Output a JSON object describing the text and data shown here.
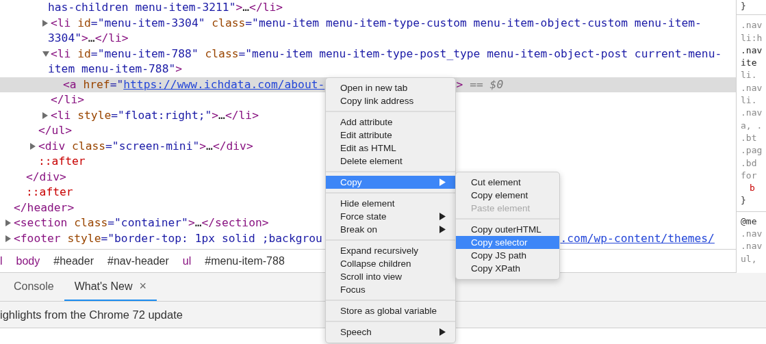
{
  "dom_tree": [
    {
      "selected": false,
      "children": [
        {
          "selected": false,
          "children": [
            {
              "selected": false,
              "children": [
                {
                  "selected": false,
                  "wrapped": [
                    [
                      {
                        "kind": "val",
                        "text": "has-children menu-item-3211\""
                      },
                      {
                        "kind": "tag",
                        "text": ">"
                      },
                      {
                        "kind": "text",
                        "text": "…"
                      },
                      {
                        "kind": "tag",
                        "text": "</li>"
                      }
                    ]
                  ]
                },
                {
                  "selected": false,
                  "expanded": false,
                  "open": [
                    {
                      "kind": "tag",
                      "text": "<li"
                    },
                    {
                      "kind": "attr",
                      "text": " id"
                    },
                    {
                      "kind": "val",
                      "text": "=\"menu-item-3304\""
                    },
                    {
                      "kind": "attr",
                      "text": " class"
                    },
                    {
                      "kind": "val",
                      "text": "=\"menu-item menu-item-type-custom menu-item-object-custom menu-item-"
                    }
                  ],
                  "wrapped": [
                    [
                      {
                        "kind": "val",
                        "text": "3304\""
                      },
                      {
                        "kind": "tag",
                        "text": ">"
                      },
                      {
                        "kind": "text",
                        "text": "…"
                      },
                      {
                        "kind": "tag",
                        "text": "</li>"
                      }
                    ]
                  ]
                },
                {
                  "selected": false,
                  "expanded": true,
                  "open": [
                    {
                      "kind": "tag",
                      "text": "<li"
                    },
                    {
                      "kind": "attr",
                      "text": " id"
                    },
                    {
                      "kind": "val",
                      "text": "=\"menu-item-788\""
                    },
                    {
                      "kind": "attr",
                      "text": " class"
                    },
                    {
                      "kind": "val",
                      "text": "=\"menu-item menu-item-type-post_type menu-item-object-post current-menu-"
                    }
                  ],
                  "wrapped": [
                    [
                      {
                        "kind": "val",
                        "text": "item menu-item-788\""
                      },
                      {
                        "kind": "tag",
                        "text": ">"
                      }
                    ]
                  ],
                  "children": [
                    {
                      "selected": true,
                      "open": [
                        {
                          "kind": "tag",
                          "text": "<a"
                        },
                        {
                          "kind": "attr",
                          "text": " href"
                        },
                        {
                          "kind": "val",
                          "text": "=\""
                        },
                        {
                          "kind": "link",
                          "text": "https://www.ichdata.com/about-"
                        },
                        {
                          "kind": "tag",
                          "text": ">",
                          "covered_before": true
                        },
                        {
                          "kind": "eq",
                          "text": " == "
                        },
                        {
                          "kind": "eqi",
                          "text": "$0"
                        }
                      ]
                    }
                  ],
                  "close": [
                    {
                      "kind": "tag",
                      "text": "</li>"
                    }
                  ]
                },
                {
                  "selected": false,
                  "expanded": false,
                  "open": [
                    {
                      "kind": "tag",
                      "text": "<li"
                    },
                    {
                      "kind": "attr",
                      "text": " style"
                    },
                    {
                      "kind": "val",
                      "text": "=\"float:right;\""
                    },
                    {
                      "kind": "tag",
                      "text": ">"
                    },
                    {
                      "kind": "text",
                      "text": "…"
                    },
                    {
                      "kind": "tag",
                      "text": "</li>"
                    }
                  ]
                }
              ],
              "close": [
                {
                  "kind": "tag",
                  "text": "</ul>"
                }
              ]
            },
            {
              "selected": false,
              "expanded": false,
              "open": [
                {
                  "kind": "tag",
                  "text": "<div"
                },
                {
                  "kind": "attr",
                  "text": " class"
                },
                {
                  "kind": "val",
                  "text": "=\"screen-mini\""
                },
                {
                  "kind": "tag",
                  "text": ">"
                },
                {
                  "kind": "text",
                  "text": "…"
                },
                {
                  "kind": "tag",
                  "text": "</div>"
                }
              ]
            },
            {
              "selected": false,
              "open": [
                {
                  "kind": "pseudo",
                  "text": "::after"
                }
              ]
            }
          ],
          "close": [
            {
              "kind": "tag",
              "text": "</div>"
            }
          ]
        },
        {
          "selected": false,
          "open": [
            {
              "kind": "pseudo",
              "text": "::after"
            }
          ]
        }
      ],
      "close": [
        {
          "kind": "tag",
          "text": "</header>"
        }
      ]
    },
    {
      "selected": false,
      "expanded": false,
      "open": [
        {
          "kind": "tag",
          "text": "<section"
        },
        {
          "kind": "attr",
          "text": " class"
        },
        {
          "kind": "val",
          "text": "=\"container\""
        },
        {
          "kind": "tag",
          "text": ">"
        },
        {
          "kind": "text",
          "text": "…"
        },
        {
          "kind": "tag",
          "text": "</section>"
        }
      ]
    },
    {
      "selected": false,
      "expanded": false,
      "open": [
        {
          "kind": "tag",
          "text": "<footer"
        },
        {
          "kind": "attr",
          "text": " style"
        },
        {
          "kind": "val",
          "text": "=\"border-top: 1px solid ;backgrou"
        },
        {
          "kind": "link",
          "text": ".com/wp-content/themes/",
          "covered_before": true
        }
      ]
    }
  ],
  "breadcrumbs": [
    {
      "text": "l",
      "kind": "tag"
    },
    {
      "text": "body",
      "kind": "tag"
    },
    {
      "text": "#header",
      "kind": "id"
    },
    {
      "text": "#nav-header",
      "kind": "id"
    },
    {
      "text": "ul",
      "kind": "tag"
    },
    {
      "text": "#menu-item-788",
      "kind": "id"
    }
  ],
  "styles_pane": [
    [
      {
        "text": "}",
        "kind": "brace"
      }
    ],
    [
      {
        "text": ".nav",
        "kind": "dim"
      },
      {
        "text": "li:h",
        "kind": "dim"
      },
      {
        "text": ".nav",
        "kind": "match"
      },
      {
        "text": "ite",
        "kind": "match"
      },
      {
        "text": "li.",
        "kind": "dim"
      },
      {
        "text": ".nav",
        "kind": "dim"
      },
      {
        "text": "li.",
        "kind": "dim"
      },
      {
        "text": ".nav",
        "kind": "dim"
      },
      {
        "text": "a, .",
        "kind": "dim"
      },
      {
        "text": ".bt",
        "kind": "dim"
      },
      {
        "text": ".pag",
        "kind": "dim"
      },
      {
        "text": ".bd",
        "kind": "dim"
      },
      {
        "text": "for",
        "kind": "dim"
      },
      {
        "text": "b",
        "kind": "prop"
      },
      {
        "text": "}",
        "kind": "brace"
      }
    ],
    [
      {
        "text": "@me",
        "kind": "brace"
      },
      {
        "text": ".nav",
        "kind": "dim"
      },
      {
        "text": ".nav",
        "kind": "dim"
      },
      {
        "text": "ul,",
        "kind": "dim"
      }
    ]
  ],
  "drawer_tabs": [
    {
      "label": "Console",
      "selected": false,
      "closable": false
    },
    {
      "label": "What's New",
      "selected": true,
      "closable": true
    }
  ],
  "drawer_close_icon": "×",
  "drawer_content": "ighlights from the Chrome 72 update",
  "context_menu": {
    "groups": [
      [
        {
          "label": "Open in new tab",
          "selected": false,
          "submenu": false
        },
        {
          "label": "Copy link address",
          "selected": false,
          "submenu": false
        }
      ],
      [
        {
          "label": "Add attribute",
          "selected": false,
          "submenu": false
        },
        {
          "label": "Edit attribute",
          "selected": false,
          "submenu": false
        },
        {
          "label": "Edit as HTML",
          "selected": false,
          "submenu": false
        },
        {
          "label": "Delete element",
          "selected": false,
          "submenu": false
        }
      ],
      [
        {
          "label": "Copy",
          "selected": true,
          "submenu": true
        }
      ],
      [
        {
          "label": "Hide element",
          "selected": false,
          "submenu": false
        },
        {
          "label": "Force state",
          "selected": false,
          "submenu": true
        },
        {
          "label": "Break on",
          "selected": false,
          "submenu": true
        }
      ],
      [
        {
          "label": "Expand recursively",
          "selected": false,
          "submenu": false
        },
        {
          "label": "Collapse children",
          "selected": false,
          "submenu": false
        },
        {
          "label": "Scroll into view",
          "selected": false,
          "submenu": false
        },
        {
          "label": "Focus",
          "selected": false,
          "submenu": false
        }
      ],
      [
        {
          "label": "Store as global variable",
          "selected": false,
          "submenu": false
        }
      ],
      [
        {
          "label": "Speech",
          "selected": false,
          "submenu": true
        }
      ]
    ]
  },
  "submenu": {
    "groups": [
      [
        {
          "label": "Cut element",
          "selected": false,
          "disabled": false
        },
        {
          "label": "Copy element",
          "selected": false,
          "disabled": false
        },
        {
          "label": "Paste element",
          "selected": false,
          "disabled": true
        }
      ],
      [
        {
          "label": "Copy outerHTML",
          "selected": false,
          "disabled": false
        },
        {
          "label": "Copy selector",
          "selected": true,
          "disabled": false
        },
        {
          "label": "Copy JS path",
          "selected": false,
          "disabled": false
        },
        {
          "label": "Copy XPath",
          "selected": false,
          "disabled": false
        }
      ]
    ]
  }
}
